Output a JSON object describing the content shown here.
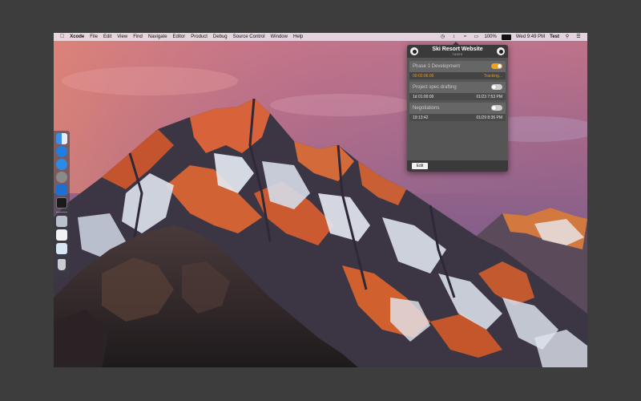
{
  "menubar": {
    "app_name": "Xcode",
    "menus": [
      "File",
      "Edit",
      "View",
      "Find",
      "Navigate",
      "Editor",
      "Product",
      "Debug",
      "Source Control",
      "Window",
      "Help"
    ],
    "battery": "100%",
    "clock": "Wed 9:49 PM",
    "user": "Test"
  },
  "popover": {
    "title": "Ski Resort Website",
    "subtitle": "TASKS",
    "tasks": [
      {
        "name": "Phase 1 Development",
        "time": "00:02:06:06",
        "status": "Tracking...",
        "on": true
      },
      {
        "name": "Project spec drafting",
        "time": "1d 01:00:00",
        "status": "01/23 7:53 PM",
        "on": false
      },
      {
        "name": "Negotiations",
        "time": "19:13:42",
        "status": "01/29 8:36 PM",
        "on": false
      }
    ],
    "edit_label": "Edit"
  },
  "colors": {
    "accent": "#f0a020",
    "popover_bg": "#555555",
    "header_bg": "#3a3a3a"
  },
  "dock_icons": [
    "finder-icon",
    "safari-icon",
    "app-store-icon",
    "system-preferences-icon",
    "xcode-icon",
    "terminal-icon",
    "preview-icon",
    "document-icon",
    "folder-icon",
    "trash-icon"
  ]
}
